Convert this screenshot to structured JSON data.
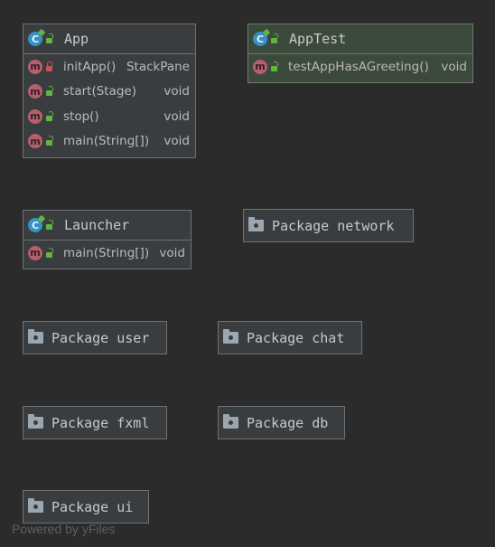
{
  "classes": {
    "app": {
      "name": "App",
      "methods": [
        {
          "name": "initApp()",
          "type": "StackPane",
          "visibility": "private"
        },
        {
          "name": "start(Stage)",
          "type": "void",
          "visibility": "public"
        },
        {
          "name": "stop()",
          "type": "void",
          "visibility": "public"
        },
        {
          "name": "main(String[])",
          "type": "void",
          "visibility": "public"
        }
      ]
    },
    "app_test": {
      "name": "AppTest",
      "methods": [
        {
          "name": "testAppHasAGreeting()",
          "type": "void",
          "visibility": "public"
        }
      ]
    },
    "launcher": {
      "name": "Launcher",
      "methods": [
        {
          "name": "main(String[])",
          "type": "void",
          "visibility": "public"
        }
      ]
    }
  },
  "icons": {
    "class": "C",
    "method": "m"
  },
  "packages": {
    "network": "Package network",
    "user": "Package user",
    "chat": "Package chat",
    "fxml": "Package fxml",
    "db": "Package db",
    "ui": "Package ui"
  },
  "watermark": "Powered by yFiles",
  "colors": {
    "background": "#2b2b2b",
    "node": "#3a3d3f",
    "test_node": "#3c4a3c",
    "class_icon": "#3592c4",
    "method_icon": "#b35f6d",
    "public": "#62b543",
    "private": "#c75450"
  }
}
